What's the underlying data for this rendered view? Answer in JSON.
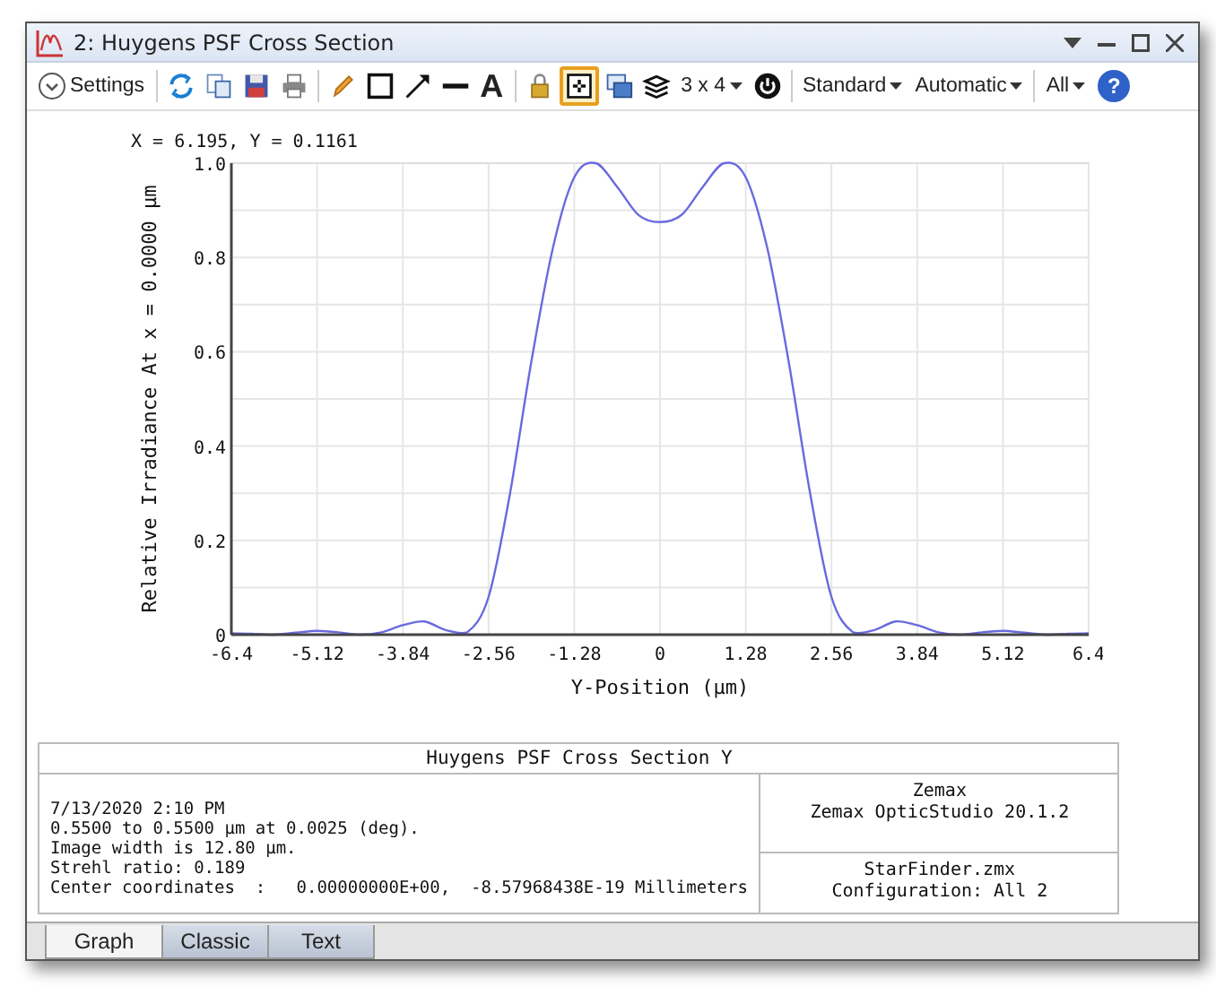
{
  "window": {
    "title": "2: Huygens PSF Cross Section"
  },
  "toolbar": [
    [
      {
        "kind": "settings",
        "label": "Settings",
        "pressed": false
      }
    ],
    [
      {
        "kind": "refresh",
        "pressed": false
      },
      {
        "kind": "copy",
        "pressed": false
      },
      {
        "kind": "save",
        "pressed": false
      },
      {
        "kind": "print",
        "pressed": false
      }
    ],
    [
      {
        "kind": "pencil",
        "pressed": false
      },
      {
        "kind": "rectangle",
        "pressed": false
      },
      {
        "kind": "arrow",
        "pressed": false
      },
      {
        "kind": "line",
        "pressed": false
      },
      {
        "kind": "text",
        "label": "A",
        "pressed": false
      }
    ],
    [
      {
        "kind": "lock",
        "pressed": false
      },
      {
        "kind": "grid",
        "pressed": true
      },
      {
        "kind": "windows",
        "pressed": false
      },
      {
        "kind": "layers",
        "pressed": false
      },
      {
        "kind": "dropdown",
        "label": "3 x 4",
        "pressed": false
      },
      {
        "kind": "power",
        "pressed": false
      }
    ],
    [
      {
        "kind": "dropdown",
        "label": "Standard",
        "pressed": false
      },
      {
        "kind": "dropdown",
        "label": "Automatic",
        "pressed": false
      }
    ],
    [
      {
        "kind": "dropdown",
        "label": "All",
        "pressed": false
      },
      {
        "kind": "help",
        "label": "?",
        "pressed": false
      }
    ]
  ],
  "cursor_readout": "X = 6.195, Y = 0.1161",
  "chart_data": {
    "type": "line",
    "grid": true,
    "xlabel": "Y-Position (µm)",
    "ylabel": "Relative Irradiance At x = 0.0000 µm",
    "x": [
      -6.4,
      -6.08,
      -5.76,
      -5.44,
      -5.12,
      -4.8,
      -4.48,
      -4.16,
      -3.84,
      -3.52,
      -3.2,
      -2.88,
      -2.56,
      -2.24,
      -1.92,
      -1.6,
      -1.28,
      -0.96,
      -0.64,
      -0.32,
      0,
      0.32,
      0.64,
      0.96,
      1.28,
      1.6,
      1.92,
      2.24,
      2.56,
      2.88,
      3.2,
      3.52,
      3.84,
      4.16,
      4.48,
      4.8,
      5.12,
      5.44,
      5.76,
      6.08,
      6.4
    ],
    "series": [
      {
        "color": "#6a6ae0",
        "values": [
          0.003,
          0.002,
          0,
          0.004,
          0.008,
          0.005,
          0,
          0.005,
          0.02,
          0.028,
          0.01,
          0.005,
          0.08,
          0.3,
          0.58,
          0.82,
          0.97,
          1.0,
          0.95,
          0.89,
          0.875,
          0.89,
          0.95,
          1.0,
          0.97,
          0.82,
          0.58,
          0.3,
          0.08,
          0.005,
          0.01,
          0.028,
          0.02,
          0.005,
          0,
          0.005,
          0.008,
          0.004,
          0,
          0.002,
          0.003
        ]
      }
    ],
    "xlim": [
      -6.4,
      6.4
    ],
    "ylim": [
      0,
      1
    ],
    "xticks": [
      -6.4,
      -5.12,
      -3.84,
      -2.56,
      -1.28,
      0,
      1.28,
      2.56,
      3.84,
      5.12,
      6.4
    ],
    "yticks": [
      0,
      0.2,
      0.4,
      0.6,
      0.8,
      {
        "value": 1,
        "label": "1.0"
      }
    ]
  },
  "report": {
    "title": "Huygens PSF Cross Section Y",
    "lines": [
      "7/13/2020 2:10 PM",
      "0.5500 to 0.5500 µm at 0.0025 (deg).",
      "Image width is 12.80 µm.",
      "Strehl ratio: 0.189",
      "Center coordinates  :   0.00000000E+00,  -8.57968438E-19 Millimeters"
    ],
    "program": [
      "Zemax",
      "Zemax OpticStudio 20.1.2"
    ],
    "file": [
      "StarFinder.zmx",
      "Configuration: All 2"
    ]
  },
  "tabs": [
    {
      "label": "Graph",
      "selected": true
    },
    {
      "label": "Classic",
      "selected": false
    },
    {
      "label": "Text",
      "selected": false
    }
  ]
}
